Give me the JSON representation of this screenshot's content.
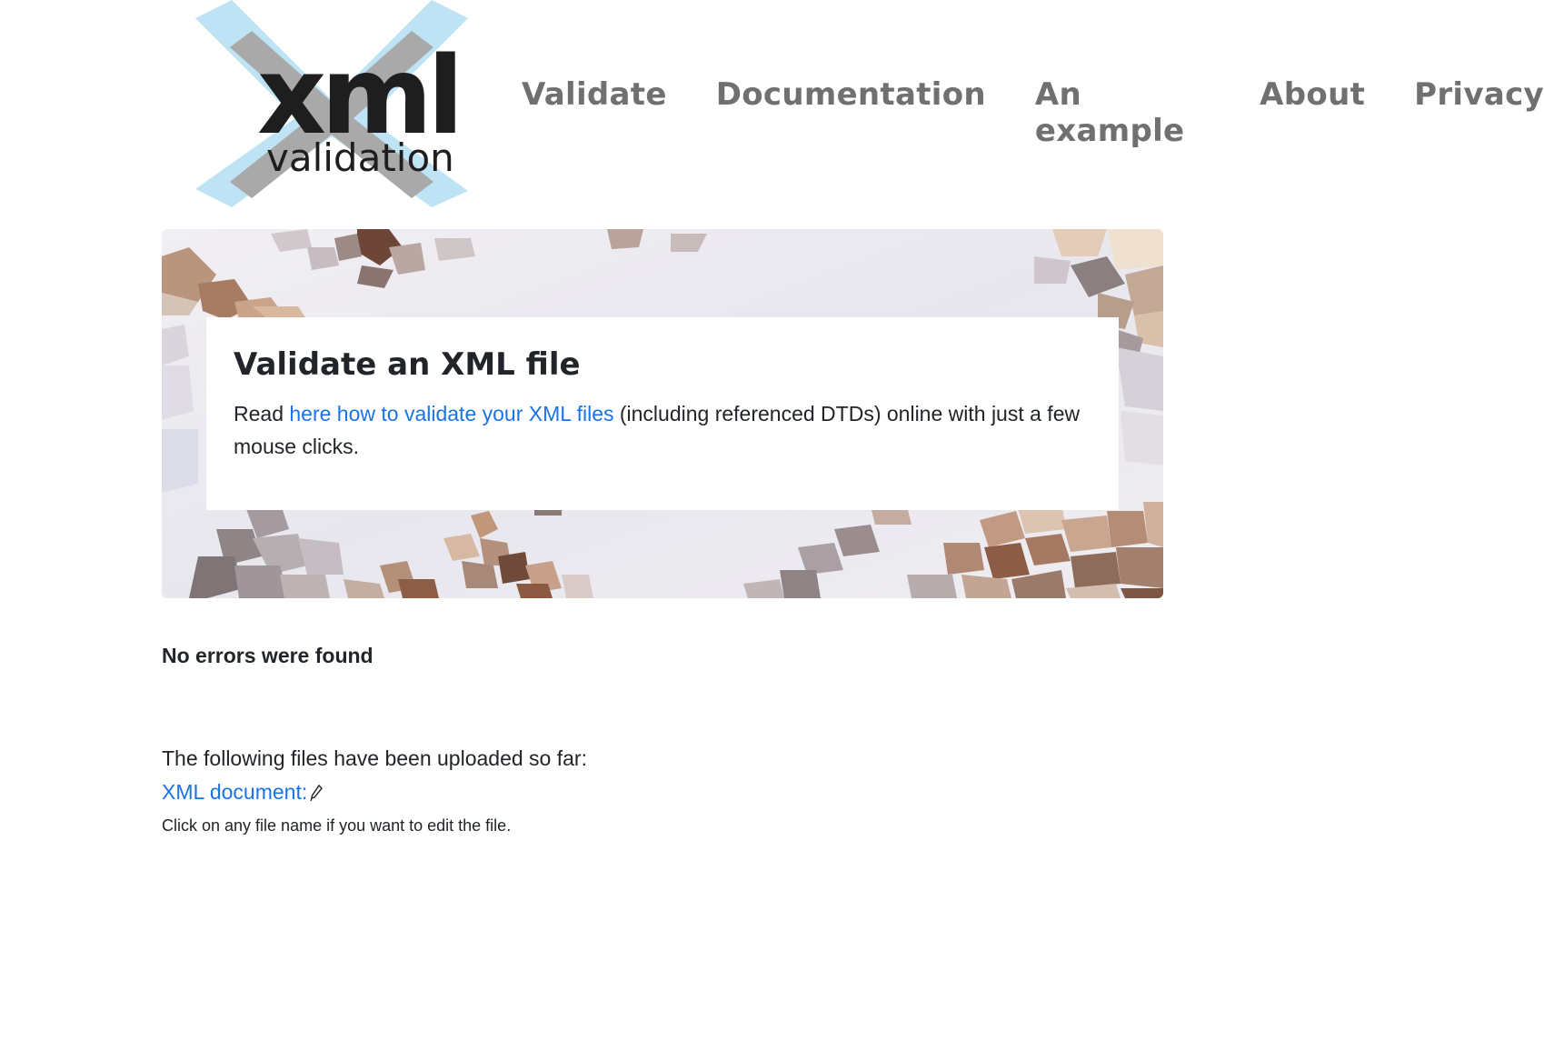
{
  "logo": {
    "text_main": "xml",
    "text_sub": "validation",
    "colors": {
      "cross_light": "#bde3f5",
      "cross_dark": "#a9a9a9",
      "text": "#1e1e1e"
    }
  },
  "nav": {
    "items": [
      {
        "label": "Validate"
      },
      {
        "label": "Documentation"
      },
      {
        "label": "An example"
      },
      {
        "label": "About"
      },
      {
        "label": "Privacy"
      }
    ]
  },
  "hero": {
    "title": "Validate an XML file",
    "text_before": "Read ",
    "link_text": "here how to validate your XML files",
    "text_after": " (including referenced DTDs) online with just a few mouse clicks."
  },
  "result": {
    "status": "No errors were found"
  },
  "uploads": {
    "intro": "The following files have been uploaded so far:",
    "files": [
      {
        "label": "XML document:",
        "icon": "pencil-icon"
      }
    ],
    "hint": "Click on any file name if you want to edit the file."
  },
  "colors": {
    "link": "#1a73e8",
    "nav": "#707070",
    "text": "#212529"
  }
}
